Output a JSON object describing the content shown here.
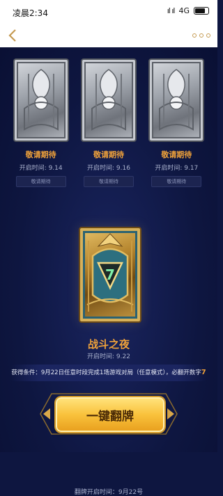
{
  "status_bar": {
    "time": "凌晨2:34",
    "network": "4G",
    "signal_text": "ıl ıl"
  },
  "nav": {
    "accent_color": "#c59a52"
  },
  "cards": [
    {
      "title": "敬请期待",
      "open_time": "开启时间: 9.14",
      "button": "敬请期待"
    },
    {
      "title": "敬请期待",
      "open_time": "开启时间: 9.16",
      "button": "敬请期待"
    },
    {
      "title": "敬请期待",
      "open_time": "开启时间: 9.17",
      "button": "敬请期待"
    }
  ],
  "featured": {
    "title": "战斗之夜",
    "open_time": "开启时间: 9.22",
    "emblem_number": "7"
  },
  "condition": {
    "text": "获得条件：9月22日任意时段完成1场游戏对局（任意模式），必翻开数字",
    "digit": "7"
  },
  "flip_button": {
    "label": "一键翻牌"
  },
  "flip_open_time": "翻牌开启时间：9月22号",
  "colors": {
    "background": "#0e1640",
    "accent_orange": "#f0a23a",
    "button_gold": "#f9c23c"
  }
}
